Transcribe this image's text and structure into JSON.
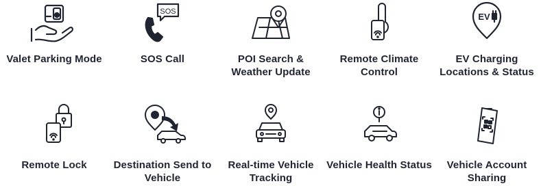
{
  "features": [
    {
      "label": "Valet Parking Mode",
      "icon": "valet-hand-phone-icon"
    },
    {
      "label": "SOS Call",
      "icon": "phone-sos-icon"
    },
    {
      "label": "POI Search & Weather Update",
      "icon": "map-pin-icon"
    },
    {
      "label": "Remote Climate Control",
      "icon": "thermometer-phone-icon"
    },
    {
      "label": "EV Charging Locations & Status",
      "icon": "ev-charging-pin-icon"
    },
    {
      "label": "Remote Lock",
      "icon": "lock-phone-icon"
    },
    {
      "label": "Destination Send to Vehicle",
      "icon": "pin-arrow-car-icon"
    },
    {
      "label": "Real-time Vehicle Tracking",
      "icon": "car-location-icon"
    },
    {
      "label": "Vehicle Health Status",
      "icon": "car-info-icon"
    },
    {
      "label": "Vehicle Account Sharing",
      "icon": "phone-qr-icon"
    }
  ],
  "sos_text": "SOS",
  "ev_text": "EV"
}
